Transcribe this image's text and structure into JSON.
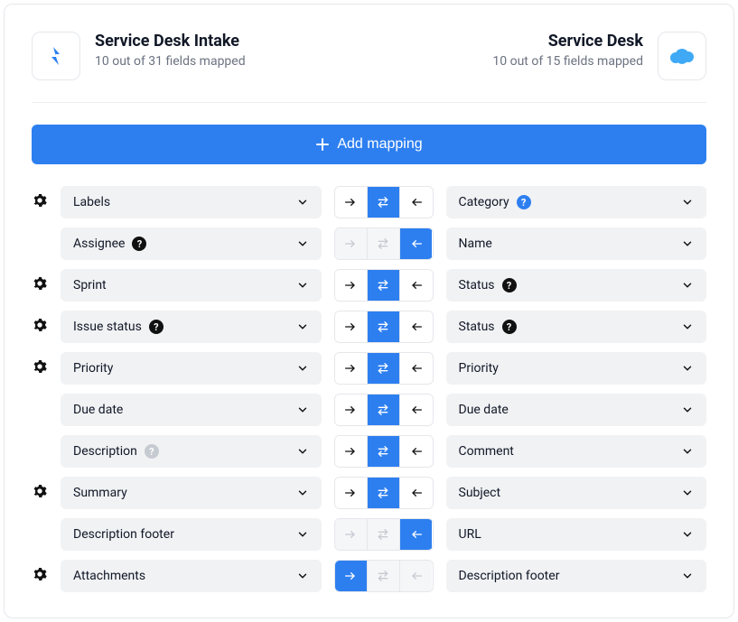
{
  "header": {
    "left": {
      "title": "Service Desk Intake",
      "subtitle": "10 out of 31 fields mapped"
    },
    "right": {
      "title": "Service Desk",
      "subtitle": "10 out of 15 fields mapped"
    }
  },
  "actions": {
    "add_mapping_label": "Add mapping"
  },
  "rows": [
    {
      "gear": true,
      "left": {
        "label": "Labels",
        "badge": null
      },
      "dir": {
        "mode": "both",
        "active": "both"
      },
      "right": {
        "label": "Category",
        "badge": "blue"
      }
    },
    {
      "gear": false,
      "left": {
        "label": "Assignee",
        "badge": "black"
      },
      "dir": {
        "mode": "left-only",
        "active": "left"
      },
      "right": {
        "label": "Name",
        "badge": null
      }
    },
    {
      "gear": true,
      "left": {
        "label": "Sprint",
        "badge": null
      },
      "dir": {
        "mode": "both",
        "active": "both"
      },
      "right": {
        "label": "Status",
        "badge": "black"
      }
    },
    {
      "gear": true,
      "left": {
        "label": "Issue status",
        "badge": "black"
      },
      "dir": {
        "mode": "both",
        "active": "both"
      },
      "right": {
        "label": "Status",
        "badge": "black"
      }
    },
    {
      "gear": true,
      "left": {
        "label": "Priority",
        "badge": null
      },
      "dir": {
        "mode": "both",
        "active": "both"
      },
      "right": {
        "label": "Priority",
        "badge": null
      }
    },
    {
      "gear": false,
      "left": {
        "label": "Due date",
        "badge": null
      },
      "dir": {
        "mode": "both",
        "active": "both"
      },
      "right": {
        "label": "Due date",
        "badge": null
      }
    },
    {
      "gear": false,
      "left": {
        "label": "Description",
        "badge": "grey"
      },
      "dir": {
        "mode": "both",
        "active": "both"
      },
      "right": {
        "label": "Comment",
        "badge": null
      }
    },
    {
      "gear": true,
      "left": {
        "label": "Summary",
        "badge": null
      },
      "dir": {
        "mode": "both",
        "active": "both"
      },
      "right": {
        "label": "Subject",
        "badge": null
      }
    },
    {
      "gear": false,
      "left": {
        "label": "Description footer",
        "badge": null
      },
      "dir": {
        "mode": "left-only",
        "active": "left"
      },
      "right": {
        "label": "URL",
        "badge": null
      }
    },
    {
      "gear": true,
      "left": {
        "label": "Attachments",
        "badge": null
      },
      "dir": {
        "mode": "right-only",
        "active": "right"
      },
      "right": {
        "label": "Description footer",
        "badge": null
      }
    }
  ]
}
